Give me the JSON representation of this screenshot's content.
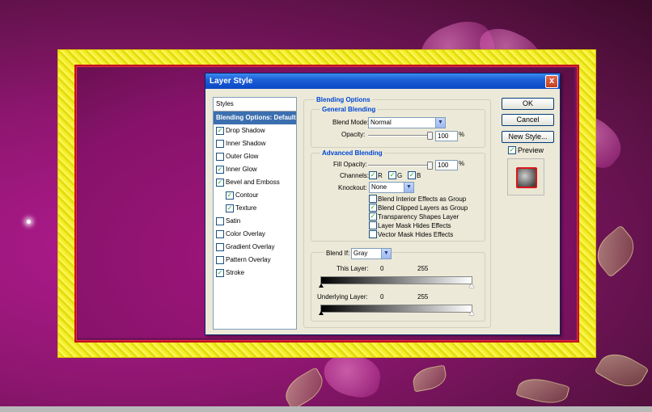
{
  "dialog": {
    "title": "Layer Style",
    "close_label": "x"
  },
  "styles_panel": {
    "header": "Styles",
    "items": [
      {
        "label": "Blending Options: Default",
        "selected": true
      },
      {
        "label": "Drop Shadow",
        "checked": true
      },
      {
        "label": "Inner Shadow",
        "checked": false
      },
      {
        "label": "Outer Glow",
        "checked": false
      },
      {
        "label": "Inner Glow",
        "checked": true
      },
      {
        "label": "Bevel and Emboss",
        "checked": true
      },
      {
        "label": "Contour",
        "checked": true,
        "sub": true
      },
      {
        "label": "Texture",
        "checked": true,
        "sub": true
      },
      {
        "label": "Satin",
        "checked": false
      },
      {
        "label": "Color Overlay",
        "checked": false
      },
      {
        "label": "Gradient Overlay",
        "checked": false
      },
      {
        "label": "Pattern Overlay",
        "checked": false
      },
      {
        "label": "Stroke",
        "checked": true
      }
    ]
  },
  "blending_options": {
    "heading": "Blending Options",
    "general": {
      "heading": "General Blending",
      "blend_mode_label": "Blend Mode:",
      "blend_mode_value": "Normal",
      "opacity_label": "Opacity:",
      "opacity_value": "100",
      "opacity_unit": "%"
    },
    "advanced": {
      "heading": "Advanced Blending",
      "fill_opacity_label": "Fill Opacity:",
      "fill_opacity_value": "100",
      "fill_opacity_unit": "%",
      "channels_label": "Channels:",
      "channel_r": "R",
      "channel_g": "G",
      "channel_b": "B",
      "knockout_label": "Knockout:",
      "knockout_value": "None",
      "options": [
        {
          "label": "Blend Interior Effects as Group",
          "checked": false
        },
        {
          "label": "Blend Clipped Layers as Group",
          "checked": true
        },
        {
          "label": "Transparency Shapes Layer",
          "checked": true
        },
        {
          "label": "Layer Mask Hides Effects",
          "checked": false
        },
        {
          "label": "Vector Mask Hides Effects",
          "checked": false
        }
      ]
    },
    "blend_if": {
      "label": "Blend If:",
      "value": "Gray",
      "this_layer_label": "This Layer:",
      "this_layer_min": "0",
      "this_layer_max": "255",
      "underlying_label": "Underlying Layer:",
      "underlying_min": "0",
      "underlying_max": "255"
    }
  },
  "buttons": {
    "ok": "OK",
    "cancel": "Cancel",
    "new_style": "New Style...",
    "preview_label": "Preview"
  },
  "check_mark": "✓"
}
